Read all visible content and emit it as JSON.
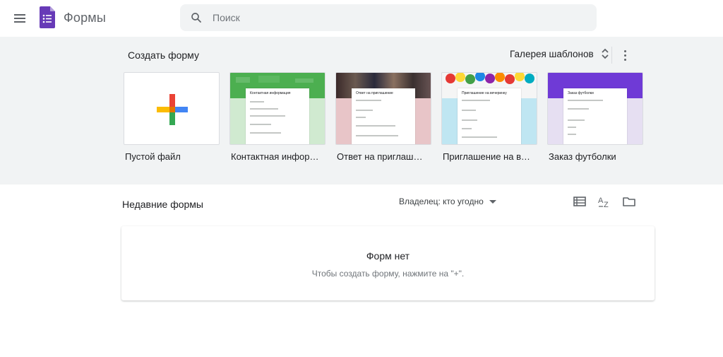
{
  "header": {
    "app_title": "Формы",
    "search_placeholder": "Поиск",
    "search_value": ""
  },
  "templates": {
    "create_label": "Создать форму",
    "gallery_label": "Галерея шаблонов",
    "cards": [
      {
        "label": "Пустой файл",
        "icon": "plus-icon"
      },
      {
        "label": "Контактная информация",
        "form_title": "Контактная информация",
        "accent": "#4caf50",
        "bg": "#d0ead0"
      },
      {
        "label": "Ответ на приглашение",
        "form_title": "Ответ на приглашение",
        "accent": "#c0a0a5",
        "bg": "#e8c5c8"
      },
      {
        "label": "Приглашение на вечеринку",
        "form_title": "Приглашение на вечеринку",
        "accent": "#5bb8d0",
        "bg": "#bfe6f2"
      },
      {
        "label": "Заказ футболки",
        "form_title": "Заказ футболки",
        "accent": "#6f3ad6",
        "bg": "#e6dff2"
      }
    ]
  },
  "recent": {
    "title": "Недавние формы",
    "owner_filter": "Владелец: кто угодно",
    "empty_title": "Форм нет",
    "empty_subtitle": "Чтобы создать форму, нажмите на \"+\"."
  },
  "colors": {
    "brand_purple": "#673ab7",
    "template_bg": "#f1f3f4"
  }
}
